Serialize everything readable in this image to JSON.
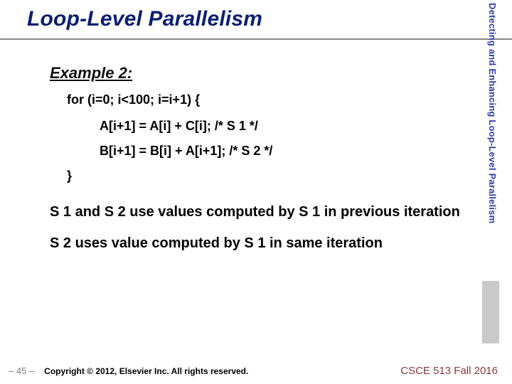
{
  "title": "Loop-Level Parallelism",
  "sidebar_label": "Detecting and Enhancing Loop-Level Parallelism",
  "example_heading": "Example 2:",
  "code": {
    "for_line": "for (i=0; i<100; i=i+1) {",
    "stmt1": "A[i+1] = A[i] + C[i]; /* S 1 */",
    "stmt2": "B[i+1] = B[i] + A[i+1]; /* S 2 */",
    "close_brace": "}"
  },
  "para1": "S 1 and S 2 use values computed by S 1 in previous iteration",
  "para2": "S 2 uses value computed by S 1 in same iteration",
  "footer": {
    "page": "– 45 –",
    "copyright": "Copyright © 2012, Elsevier Inc. All rights reserved.",
    "course": "CSCE 513 Fall 2016"
  }
}
